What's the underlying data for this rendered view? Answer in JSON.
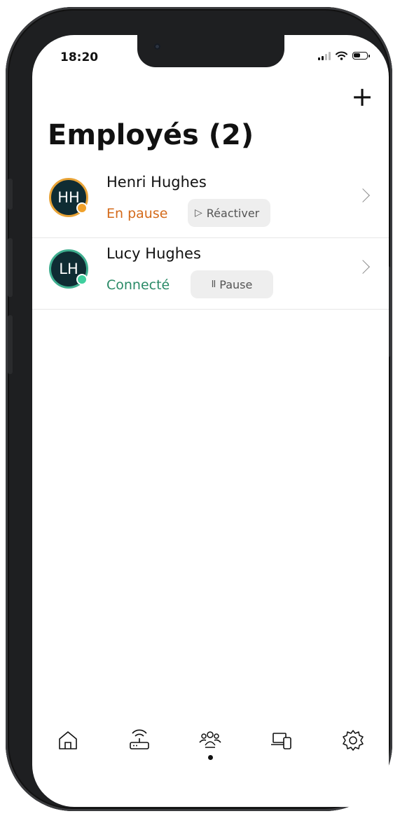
{
  "status_bar": {
    "time": "18:20"
  },
  "header": {
    "add_label": "+",
    "title": "Employés (2)"
  },
  "colors": {
    "paused": "#d46a1a",
    "connected": "#2a8a67",
    "avatar_bg": "#0f2c33",
    "paused_dot": "#f0a12b",
    "online_dot": "#3fcf9e"
  },
  "employees": [
    {
      "initials": "HH",
      "name": "Henri Hughes",
      "status": "En pause",
      "action_icon": "▷",
      "action_label": "Réactiver"
    },
    {
      "initials": "LH",
      "name": "Lucy Hughes",
      "status": "Connecté",
      "action_icon": "II",
      "action_label": "Pause"
    }
  ],
  "tab_bar": {
    "tabs": [
      "home-icon",
      "router-icon",
      "people-icon",
      "devices-icon",
      "settings-icon"
    ],
    "active": "people-icon"
  }
}
